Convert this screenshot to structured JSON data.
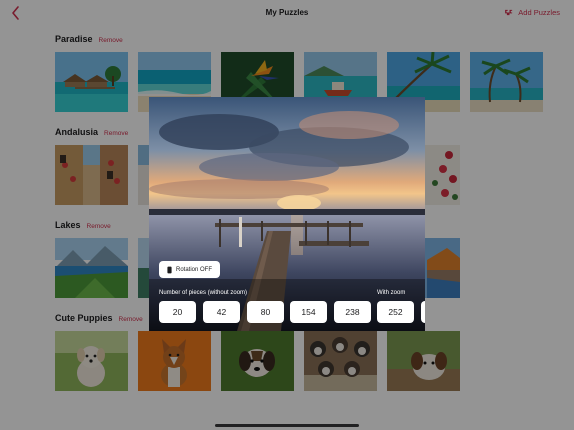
{
  "nav": {
    "title": "My Puzzles",
    "back_icon": "chevron-left-icon",
    "add_label": "Add Puzzles",
    "add_icon": "puzzle-pieces-icon",
    "accent": "#d0304e"
  },
  "sections": [
    {
      "name": "Paradise",
      "remove_label": "Remove",
      "thumbnails": [
        "beach bungalows",
        "turquoise shore",
        "bird of paradise flower",
        "lagoon boat",
        "palm over sea",
        "palm trees beach"
      ]
    },
    {
      "name": "Andalusia",
      "remove_label": "Remove",
      "thumbnails": [
        "flowered street",
        "white village",
        "red flowers on wall"
      ]
    },
    {
      "name": "Lakes",
      "remove_label": "Remove",
      "thumbnails": [
        "mountain lake",
        "alpine lake",
        "autumn lake"
      ]
    },
    {
      "name": "Cute Puppies",
      "remove_label": "Remove",
      "thumbnails": [
        "white puppy on grass",
        "corgi puppy",
        "beagle puppy",
        "puppies in box",
        "puppy on wood"
      ]
    }
  ],
  "modal": {
    "photo": "pier at sunset over lake",
    "rotation_label": "Rotation OFF",
    "rotation_icon": "phone-rotation-icon",
    "pieces_label": "Number of pieces (without zoom)",
    "zoom_label": "With zoom",
    "pieces": [
      "20",
      "42",
      "80",
      "154",
      "238",
      "252"
    ]
  }
}
